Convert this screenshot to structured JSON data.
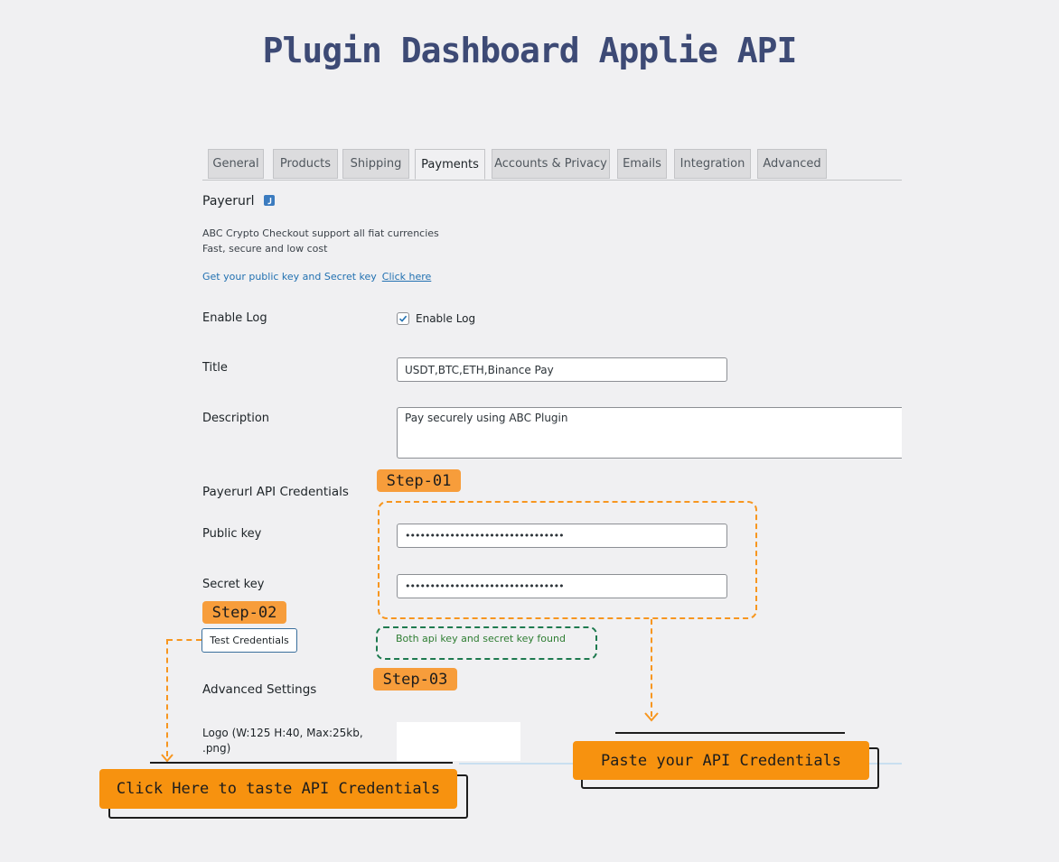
{
  "page_title": "Plugin Dashboard Applie API",
  "tabs": [
    {
      "label": "General"
    },
    {
      "label": "Products"
    },
    {
      "label": "Shipping"
    },
    {
      "label": "Payments",
      "active": true
    },
    {
      "label": "Accounts & Privacy"
    },
    {
      "label": "Emails"
    },
    {
      "label": "Integration"
    },
    {
      "label": "Advanced"
    }
  ],
  "section": {
    "title": "Payerurl",
    "desc_line1": "ABC Crypto Checkout support all fiat currencies",
    "desc_line2": "Fast, secure and low cost",
    "keys_text": "Get your public key and Secret key",
    "keys_link": "Click here"
  },
  "form": {
    "enable_log_label": "Enable Log",
    "enable_log_checkbox_label": "Enable Log",
    "enable_log_checked": true,
    "title_label": "Title",
    "title_value": "USDT,BTC,ETH,Binance Pay",
    "description_label": "Description",
    "description_value": "Pay securely using ABC Plugin",
    "credentials_heading": "Payerurl API Credentials",
    "public_key_label": "Public key",
    "public_key_value": "••••••••••••••••••••••••••••••••",
    "secret_key_label": "Secret key",
    "secret_key_value": "••••••••••••••••••••••••••••••••",
    "test_button": "Test Credentials",
    "test_result": "Both api key and secret key found",
    "advanced_heading": "Advanced Settings",
    "logo_label_line1": "Logo (W:125 H:40, Max:25kb,",
    "logo_label_line2": ".png)"
  },
  "annotations": {
    "step1": "Step-01",
    "step2": "Step-02",
    "step3": "Step-03",
    "callout_left": "Click Here to taste API Credentials",
    "callout_right": "Paste your API Credentials"
  },
  "colors": {
    "accent_orange": "#f7920f",
    "title_blue": "#3d4a75",
    "success_green": "#2e7d32"
  }
}
